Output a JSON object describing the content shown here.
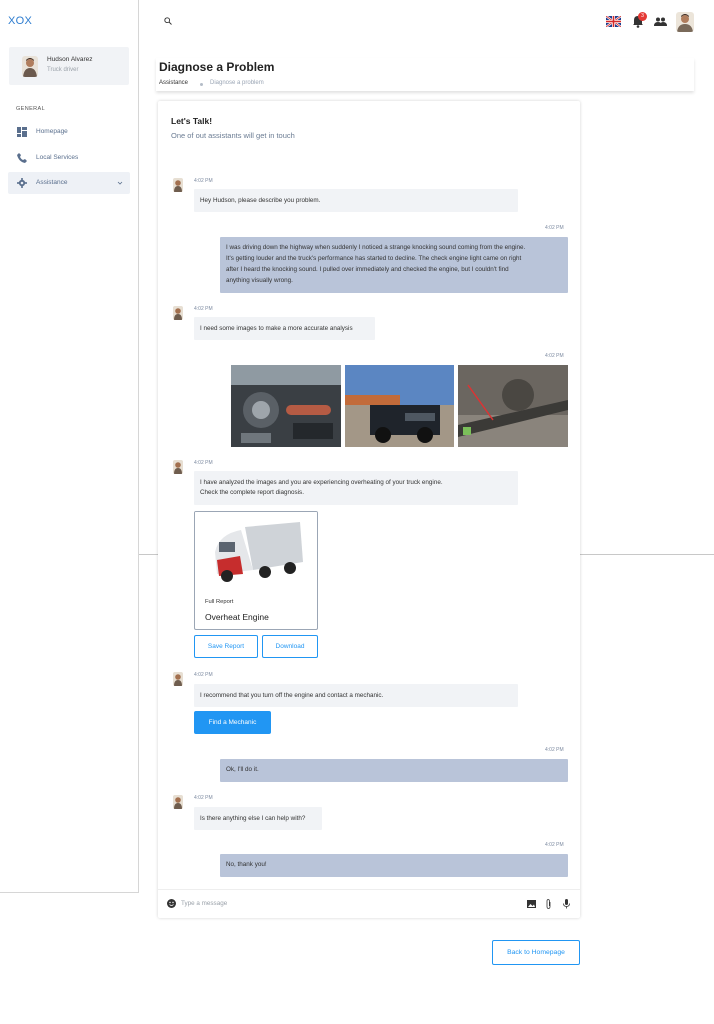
{
  "app": {
    "brand": "XOX"
  },
  "user": {
    "name": "Hudson Alvarez",
    "role": "Truck driver"
  },
  "sidebar": {
    "section": "GENERAL",
    "items": [
      {
        "label": "Homepage",
        "icon": "dashboard-icon"
      },
      {
        "label": "Local Services",
        "icon": "phone-icon"
      },
      {
        "label": "Assistance",
        "icon": "gear-icon",
        "active": true
      }
    ]
  },
  "topbar": {
    "notification_count": "3",
    "flag": "uk-flag-icon"
  },
  "header": {
    "title": "Diagnose a Problem",
    "breadcrumb": [
      "Assistance",
      "Diagnose a problem"
    ]
  },
  "chat": {
    "title": "Let's Talk!",
    "subtitle": "One of out assistants will get in touch",
    "messages": [
      {
        "from": "agent",
        "time": "4:02 PM",
        "text": "Hey Hudson, please describe you problem."
      },
      {
        "from": "user",
        "time": "4:02 PM",
        "lines": [
          "I was driving down the highway when suddenly I noticed a strange knocking sound coming from the engine.",
          "It's getting louder and the truck's performance has started to decline. The check engine light came on right",
          "after I heard the knocking sound. I pulled over immediately and checked the engine, but I couldn't find",
          "anything visually wrong."
        ]
      },
      {
        "from": "agent",
        "time": "4:02 PM",
        "text": "I need some images to make a more accurate analysis"
      },
      {
        "from": "user",
        "time": "4:02 PM",
        "type": "images"
      },
      {
        "from": "agent",
        "time": "4:02 PM",
        "lines": [
          "I have analyzed the images and you are experiencing overheating of your truck engine.",
          "Check the complete report diagnosis."
        ]
      },
      {
        "from": "agent",
        "time": "4:02 PM",
        "text": "I recommend that you turn off the engine and contact a mechanic."
      },
      {
        "from": "user",
        "time": "4:02 PM",
        "text": "Ok, I'll do it."
      },
      {
        "from": "agent",
        "time": "4:02 PM",
        "text": "Is there anything else I can help with?"
      },
      {
        "from": "user",
        "time": "4:02 PM",
        "text": "No, thank you!"
      }
    ],
    "report": {
      "kicker": "Full Report",
      "title": "Overheat Engine",
      "save_label": "Save Report",
      "download_label": "Download"
    },
    "find_mechanic_label": "Find a Mechanic",
    "composer": {
      "placeholder": "Type a message"
    }
  },
  "footer": {
    "back_label": "Back to Homepage"
  },
  "colors": {
    "accent": "#2196f3",
    "user_bubble": "#b9c4d9",
    "agent_bubble": "#f1f3f6",
    "badge": "#e53935"
  }
}
